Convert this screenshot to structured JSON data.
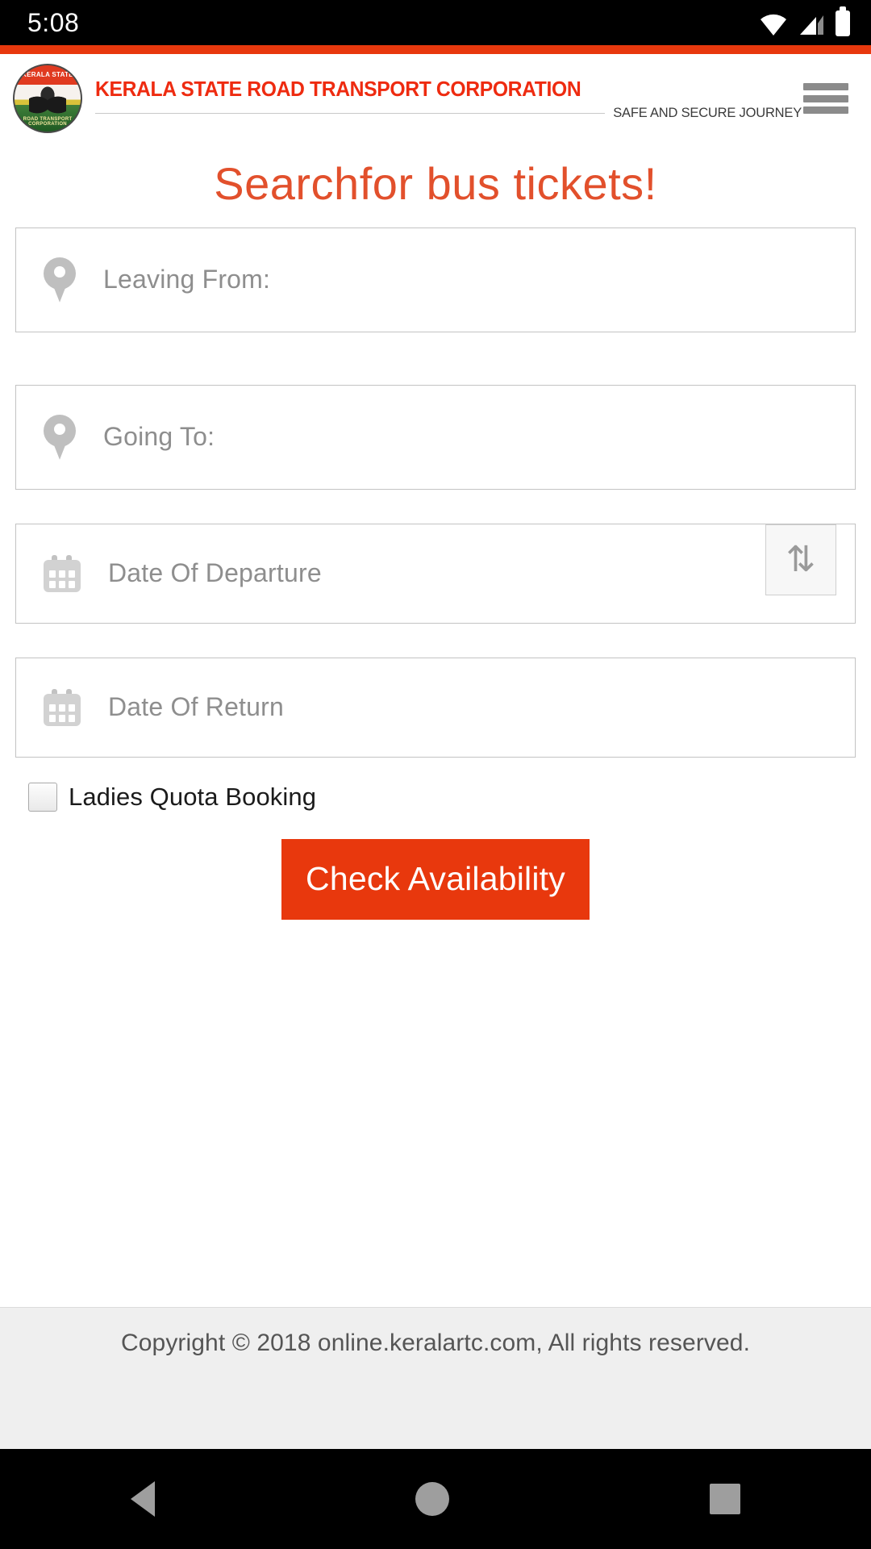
{
  "status_bar": {
    "time": "5:08",
    "icons": [
      "wifi-icon",
      "signal-icon",
      "battery-icon"
    ]
  },
  "header": {
    "logo": {
      "name": "ksrtc-emblem-logo",
      "top_text": "KERALA STATE",
      "bottom_text": "ROAD TRANSPORT CORPORATION"
    },
    "title": "KERALA STATE ROAD TRANSPORT CORPORATION",
    "subtitle": "SAFE AND SECURE JOURNEY",
    "menu_icon": "hamburger-menu-icon"
  },
  "main": {
    "heading": "Searchfor bus tickets!",
    "fields": [
      {
        "name": "leaving-from",
        "icon": "location-pin-icon",
        "placeholder": "Leaving From:",
        "value": ""
      },
      {
        "name": "going-to",
        "icon": "location-pin-icon",
        "placeholder": "Going To:",
        "value": ""
      },
      {
        "name": "date-of-departure",
        "icon": "calendar-icon",
        "placeholder": "Date Of Departure",
        "value": ""
      },
      {
        "name": "date-of-return",
        "icon": "calendar-icon",
        "placeholder": "Date Of Return",
        "value": ""
      }
    ],
    "swap_button": {
      "glyph": "⇅",
      "label": "swap-locations"
    },
    "ladies_quota": {
      "label": "Ladies Quota Booking",
      "checked": false
    },
    "submit_label": "Check Availability"
  },
  "footer": {
    "copyright": "Copyright © 2018 online.keralartc.com, All rights reserved."
  },
  "nav_bar": {
    "back": "back-icon",
    "home": "home-icon",
    "recents": "recents-icon"
  },
  "colors": {
    "brand_red": "#ee2b10",
    "accent_bar": "#e8380d",
    "heading": "#e2502c",
    "button": "#e8380d",
    "footer_bg": "#efefef",
    "placeholder": "#8e8e8e"
  }
}
